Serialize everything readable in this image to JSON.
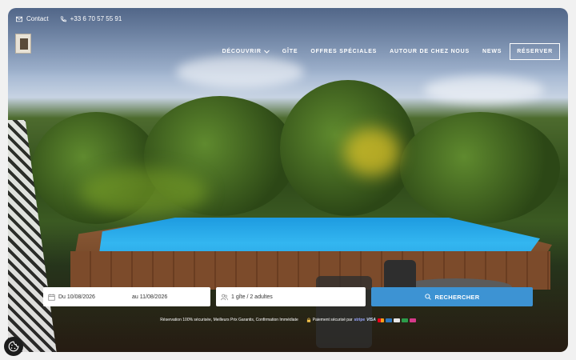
{
  "topbar": {
    "contact_label": "Contact",
    "phone": "+33 6 70 57 55 91"
  },
  "nav": {
    "items": [
      {
        "label": "DÉCOUVRIR",
        "has_dropdown": true
      },
      {
        "label": "GÎTE"
      },
      {
        "label": "OFFRES SPÉCIALES"
      },
      {
        "label": "AUTOUR DE CHEZ NOUS"
      },
      {
        "label": "NEWS"
      }
    ],
    "reserve_label": "RÉSERVER"
  },
  "booking": {
    "date_from": "Du 10/08/2026",
    "date_to": "au 11/08/2026",
    "guests": "1 gîte / 2 adultes",
    "search_label": "RECHERCHER"
  },
  "trust": {
    "text": "Réservation 100% sécurisée, Meilleurs Prix Garantis, Confirmation Immédiate",
    "payment_text": "Paiement sécurisé par",
    "payment_brands": [
      "stripe",
      "VISA"
    ]
  },
  "colors": {
    "accent": "#3d93d3",
    "pool": "#2aa4e4"
  },
  "icons": [
    "mail-icon",
    "phone-icon",
    "chevron-down-icon",
    "calendar-icon",
    "guests-icon",
    "search-icon",
    "lock-icon",
    "cookie-icon"
  ]
}
